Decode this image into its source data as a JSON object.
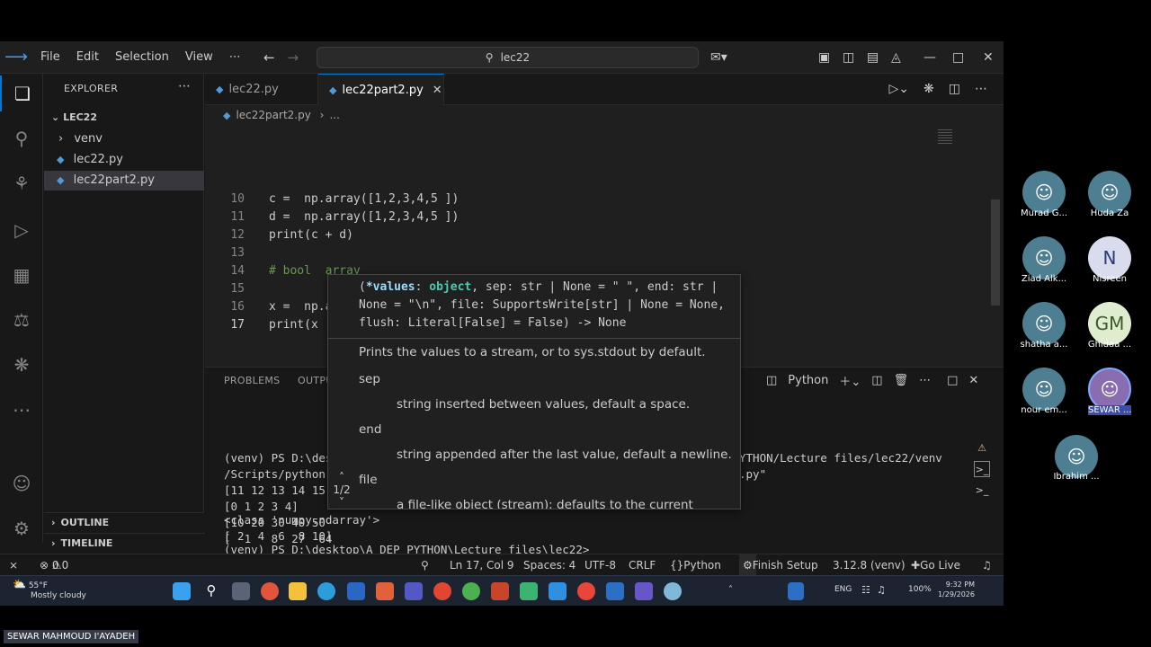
{
  "menu": [
    "File",
    "Edit",
    "Selection",
    "View"
  ],
  "search": {
    "text": "lec22"
  },
  "sidebar": {
    "title": "EXPLORER",
    "root": "LEC22",
    "items": [
      "venv",
      "lec22.py",
      "lec22part2.py"
    ],
    "outline": "OUTLINE",
    "timeline": "TIMELINE"
  },
  "tabs": [
    {
      "label": "lec22.py"
    },
    {
      "label": "lec22part2.py"
    }
  ],
  "breadcrumb": {
    "file": "lec22part2.py",
    "rest": "..."
  },
  "code": [
    {
      "n": "10",
      "text": "c =  np.array([1,2,3,4,5 ])"
    },
    {
      "n": "11",
      "text": "d =  np.array([1,2,3,4,5 ])"
    },
    {
      "n": "12",
      "text": "print(c + d)"
    },
    {
      "n": "13",
      "text": ""
    },
    {
      "n": "14",
      "text": "# bool  array"
    },
    {
      "n": "15",
      "text": ""
    },
    {
      "n": "16",
      "text": "x =  np.array([1,2,3,4,5 ])"
    },
    {
      "n": "17",
      "text": "print(x )"
    }
  ],
  "hover": {
    "sig_open": "(",
    "sig_values": "*values",
    "sig_colon": ": ",
    "sig_object": "object",
    "sig_rest1": ", sep: str | None = \" \", end: str |",
    "sig_line2": "None = \"\\n\", file: SupportsWrite[str] | None = None,",
    "sig_line3": "flush: Literal[False] = False) -> None",
    "desc": "Prints the values to a stream, or to sys.stdout by default.",
    "p1": "sep",
    "p1_desc": "string inserted between values, default a space.",
    "p2": "end",
    "p2_desc": "string appended after the last value, default a newline.",
    "p3": "file",
    "p3_desc": "a file-like object (stream); defaults to the current",
    "count": "1/2"
  },
  "panel": {
    "problems": "PROBLEMS",
    "output": "OUTPU",
    "python": "Python",
    "terminal_left": [
      "(venv) PS D:\\des",
      "/Scripts/python",
      "[11 12 13 14 15",
      "[0 1 2 3 4]",
      "[10 20 30 40 50",
      "[  1   8  27  64",
      "<class 'numpy.ndarray'>",
      "[ 2  4  6  8 10]",
      "(venv) PS D:\\desktop\\A_DEP_PYTHON\\Lecture files\\lec22> "
    ],
    "terminal_right": [
      "YTHON/Lecture files/lec22/venv",
      ".py\""
    ]
  },
  "status": {
    "errors": "0",
    "warnings": "0",
    "position": "Ln 17, Col 9",
    "spaces": "Spaces: 4",
    "encoding": "UTF-8",
    "eol": "CRLF",
    "language": "Python",
    "finish": "Finish Setup",
    "version": "3.12.8 (venv)",
    "golive": "Go Live"
  },
  "taskbar": {
    "temp": "55°F",
    "weather": "Mostly cloudy",
    "lang": "ENG",
    "battery": "100%",
    "time": "9:32 PM",
    "date": "1/29/2026"
  },
  "participants": [
    {
      "name": "Murad G...",
      "initials": ""
    },
    {
      "name": "Huda Za",
      "initials": ""
    },
    {
      "name": "Ziad Alk...",
      "initials": ""
    },
    {
      "name": "Nisreen",
      "initials": "N"
    },
    {
      "name": "shatha a...",
      "initials": ""
    },
    {
      "name": "Ghidaa ...",
      "initials": "GM"
    },
    {
      "name": "nour em...",
      "initials": ""
    },
    {
      "name": "SEWAR ...",
      "initials": ""
    },
    {
      "name": "Ibrahim ...",
      "initials": ""
    }
  ],
  "presenter": "SEWAR MAHMOUD I'AYADEH",
  "colors": {
    "accent": "#0078d4",
    "editor_bg": "#1f1f1f",
    "comment": "#6a9955",
    "param": "#9cdcfe",
    "type": "#4ec9b0"
  }
}
